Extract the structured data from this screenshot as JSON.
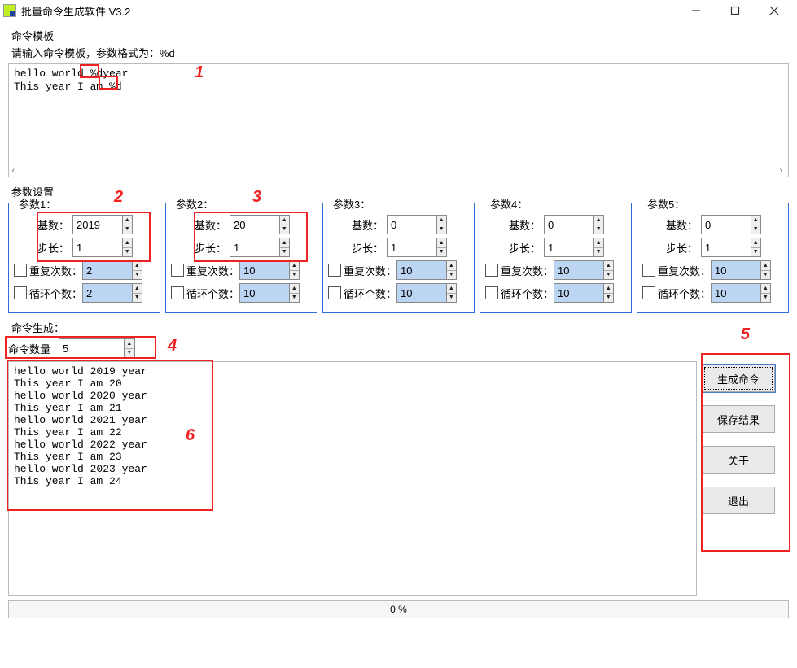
{
  "window_title": "批量命令生成软件 V3.2",
  "template_section": {
    "label": "命令模板",
    "hint": "请输入命令模板，参数格式为：%d",
    "line1_pre": "hello world ",
    "line1_token": "%d ",
    "line1_post": "year",
    "line2_pre": "This year I am ",
    "line2_token": "%d"
  },
  "param_section_label": "参数设置",
  "label_base": "基数：",
  "label_step": "步长：",
  "label_repeat": "重复次数：",
  "label_loop": "循环个数：",
  "params": [
    {
      "legend": "参数1：",
      "base": "2019",
      "step": "1",
      "repeat": "2",
      "loop": "2"
    },
    {
      "legend": "参数2：",
      "base": "20",
      "step": "1",
      "repeat": "10",
      "loop": "10"
    },
    {
      "legend": "参数3：",
      "base": "0",
      "step": "1",
      "repeat": "10",
      "loop": "10"
    },
    {
      "legend": "参数4：",
      "base": "0",
      "step": "1",
      "repeat": "10",
      "loop": "10"
    },
    {
      "legend": "参数5：",
      "base": "0",
      "step": "1",
      "repeat": "10",
      "loop": "10"
    }
  ],
  "gen": {
    "section_label": "命令生成：",
    "count_label": "命令数量",
    "count_value": "5",
    "output": "hello world 2019 year\nThis year I am 20\nhello world 2020 year\nThis year I am 21\nhello world 2021 year\nThis year I am 22\nhello world 2022 year\nThis year I am 23\nhello world 2023 year\nThis year I am 24",
    "progress": "0 %"
  },
  "buttons": {
    "generate": "生成命令",
    "save": "保存结果",
    "about": "关于",
    "exit": "退出"
  },
  "anno_nums": {
    "1": "1",
    "2": "2",
    "3": "3",
    "4": "4",
    "5": "5",
    "6": "6"
  }
}
